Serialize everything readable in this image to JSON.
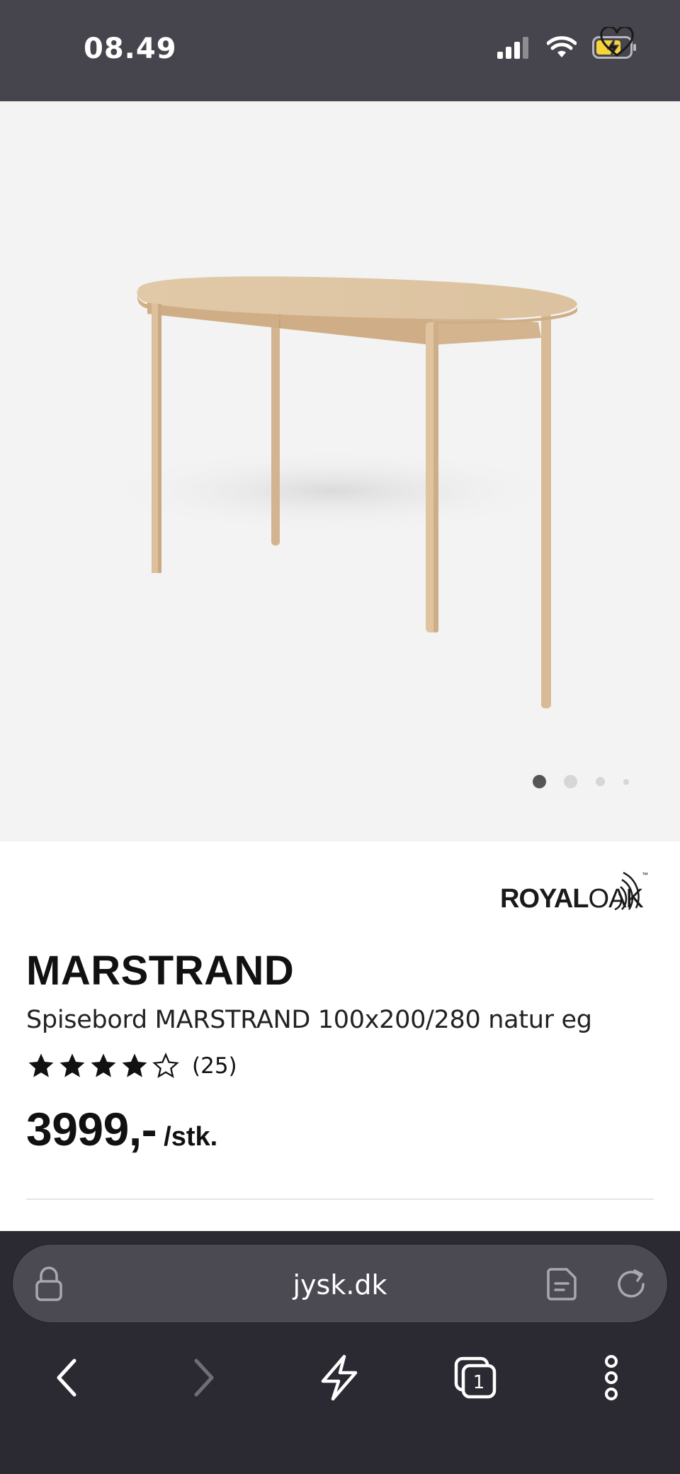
{
  "status_bar": {
    "time": "08.49",
    "icons": [
      "signal-icon",
      "wifi-icon",
      "battery-charging-icon"
    ]
  },
  "gallery": {
    "image_alt": "MARSTRAND dining table",
    "dot_count": 4,
    "active_dot": 1
  },
  "product": {
    "brand": {
      "part1": "ROYAL",
      "part2": "OAK",
      "tm": "™"
    },
    "title": "MARSTRAND",
    "subtitle": "Spisebord MARSTRAND 100x200/280 natur eg",
    "rating": {
      "value": 4,
      "max": 5,
      "count": "(25)"
    },
    "price": {
      "amount": "3999,-",
      "unit": "/stk."
    }
  },
  "browser": {
    "url": "jysk.dk",
    "tab_count": "1"
  },
  "colors": {
    "status_bg": "#46454d",
    "hero_bg": "#f3f3f3",
    "browser_bg": "#2b2a33",
    "url_bar_bg": "#4b4a53",
    "battery_accent": "#f7d43a"
  }
}
